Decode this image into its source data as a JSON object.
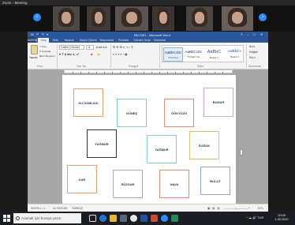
{
  "zoom": {
    "title": "Zoom - Meeting"
  },
  "participants": {
    "prev_arrow": "‹",
    "next_arrow": "›",
    "tiles": [
      {
        "name": "",
        "bg": "#4c4844"
      },
      {
        "name": "",
        "bg": "#3f3a37"
      },
      {
        "name": "",
        "bg": "#5b5350"
      },
      {
        "name": "",
        "bg": "#3b3634"
      },
      {
        "name": "",
        "bg": "#4b4641"
      },
      {
        "name": "",
        "bg": "#6a5e58"
      }
    ]
  },
  "word": {
    "doc_title": "BELGE1 - Microsoft Word",
    "qat": "W ↶ ↷ ▾",
    "window_buttons": [
      "?",
      "–",
      "□",
      "✕"
    ],
    "tabs": [
      "DOSYA",
      "Giriş",
      "Ekle",
      "Tasarım",
      "Sayfa Düzeni",
      "Başvurular",
      "Postalar",
      "Gözden Geçir",
      "Görünüm"
    ],
    "ribbon": {
      "paste_label": "Yapıştır",
      "cut": "✂ Kes",
      "copy": "⎘ Kopyala",
      "format_painter": "Biçim Boyacısı",
      "font_name": "Calibri (Gövde)",
      "font_size": "11",
      "font_buttons": "K  T  A  abc  x₂  x²",
      "font_buttons2": "A  Aa  A  A",
      "para_row1": "☰  ☰  ☰  ⇤  ⇥  ↕  ¶",
      "para_row2": "≡  ≡  ≡  ≡  ↕  ▦",
      "group_clipboard": "Pano",
      "group_font": "Yazı Tipi",
      "group_paragraph": "Paragraf",
      "group_styles": "Stiller",
      "group_editing": "Düzenleme",
      "styles": [
        {
          "sample": "AaBbCcDc",
          "name": "¶ Normal",
          "color": "#1f3863"
        },
        {
          "sample": "AaBbCcDc",
          "name": "¶ Aralık Yok",
          "color": "#1f3863"
        },
        {
          "sample": "AaBbC",
          "name": "Başlık 1",
          "color": "#2f5496"
        },
        {
          "sample": "AaBbCc",
          "name": "Başlık 2",
          "color": "#2f5496"
        }
      ],
      "editing": [
        "Bul ▾",
        "Değiştir",
        "Seç ▾"
      ]
    },
    "cards": [
      {
        "text": "SU DAMLASI"
      },
      {
        "text": "GÜNEŞ"
      },
      {
        "text": "GÖKYÜZÜ"
      },
      {
        "text": "BUHAR"
      },
      {
        "text": "YAĞMUR"
      },
      {
        "text": "YAĞMUR"
      },
      {
        "text": "SOĞUK"
      },
      {
        "text": "KAR"
      },
      {
        "text": "RÜZGAR"
      },
      {
        "text": "HAVA"
      },
      {
        "text": "BULUT"
      }
    ],
    "status": {
      "page": "SAYFA 1 / 1",
      "words": "11 SÖZCÜK",
      "lang": "TÜRKÇE",
      "zoom": "97%"
    }
  },
  "taskbar": {
    "search_placeholder": "Aramak için buraya yazın",
    "time": "20:08",
    "date": "1.05.2020",
    "tray": "^  ☁  🔊  TUR"
  },
  "colors": {
    "accent": "#2b579a",
    "zoom_blue": "#2d8cff",
    "card_border": "#aaaaaa",
    "card_text": "#1f3863"
  }
}
